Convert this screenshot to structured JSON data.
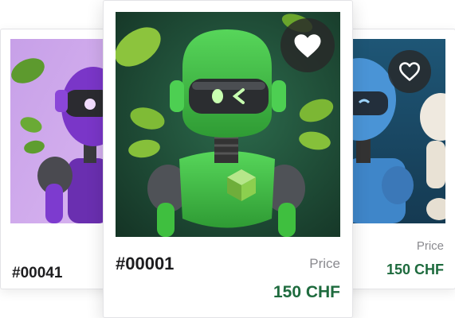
{
  "cards": {
    "left": {
      "id_label": "#00041",
      "theme_color": "#8b3fd6",
      "background": "#cda3ea",
      "favorited": false
    },
    "main": {
      "id_label": "#00001",
      "price_label": "Price",
      "price_value": "150 CHF",
      "theme_color": "#3fbf3f",
      "background": "#1d4a37",
      "favorited": true
    },
    "right": {
      "price_label": "Price",
      "price_value": "150 CHF",
      "theme_color": "#3f8ed8",
      "background": "#1c4a6a",
      "favorited": false
    }
  },
  "icons": {
    "favorite_filled": "heart-filled-icon",
    "favorite_outline": "heart-outline-icon"
  },
  "colors": {
    "price_green": "#1e6b3e",
    "id_text": "#1d1d1f",
    "price_label": "#8a8a8f"
  }
}
